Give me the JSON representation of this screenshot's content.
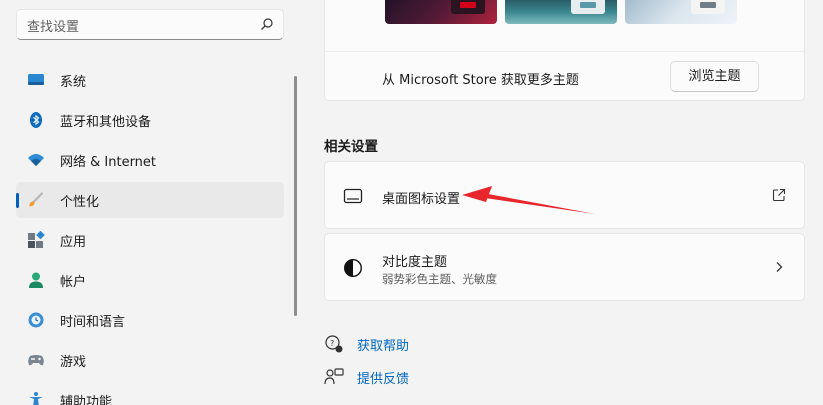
{
  "search": {
    "placeholder": "查找设置"
  },
  "nav": {
    "items": [
      {
        "label": "系统",
        "icon": "monitor-icon"
      },
      {
        "label": "蓝牙和其他设备",
        "icon": "bluetooth-icon"
      },
      {
        "label": "网络 & Internet",
        "icon": "wifi-icon"
      },
      {
        "label": "个性化",
        "icon": "brush-icon",
        "active": true
      },
      {
        "label": "应用",
        "icon": "apps-icon"
      },
      {
        "label": "帐户",
        "icon": "account-icon"
      },
      {
        "label": "时间和语言",
        "icon": "clock-globe-icon"
      },
      {
        "label": "游戏",
        "icon": "gamepad-icon"
      },
      {
        "label": "辅助功能",
        "icon": "accessibility-icon"
      }
    ]
  },
  "themes": {
    "store_text": "从 Microsoft Store 获取更多主题",
    "browse_button": "浏览主题"
  },
  "related": {
    "title": "相关设置",
    "desktop_icons": {
      "title": "桌面图标设置",
      "icon": "desktop-icon",
      "end_icon": "external-link-icon"
    },
    "contrast": {
      "title": "对比度主题",
      "subtitle": "弱势彩色主题、光敏度",
      "icon": "contrast-icon",
      "end_icon": "chevron-right-icon"
    }
  },
  "links": {
    "help": "获取帮助",
    "feedback": "提供反馈"
  },
  "colors": {
    "accent": "#005fb8",
    "link": "#0067c0",
    "annotation_arrow": "#e8262b"
  }
}
